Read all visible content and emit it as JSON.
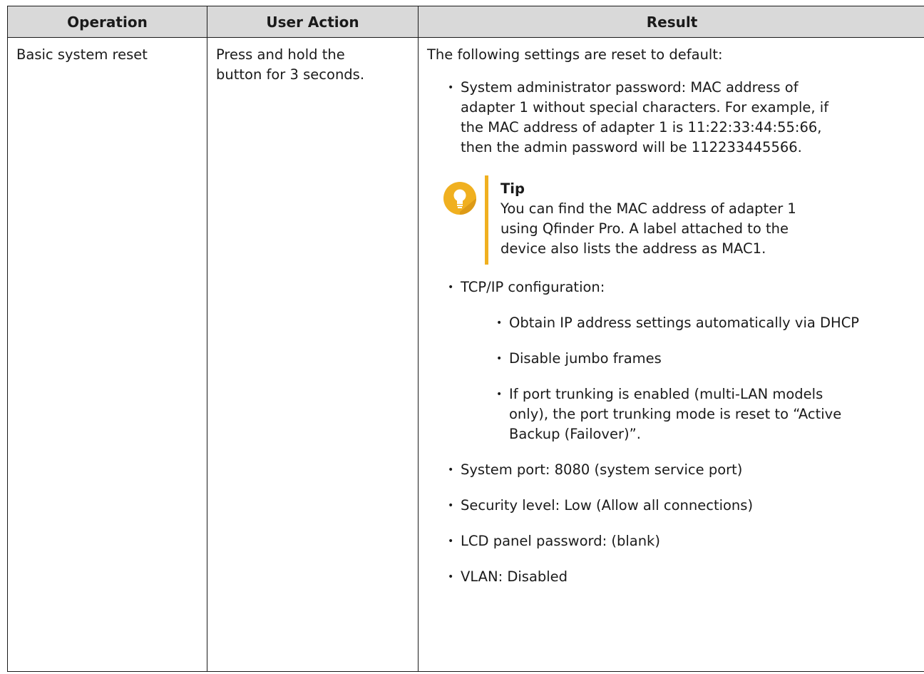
{
  "table": {
    "headers": {
      "operation": "Operation",
      "user_action": "User Action",
      "result": "Result"
    },
    "row": {
      "operation": "Basic system reset",
      "user_action_line1": "Press and hold the",
      "user_action_line2": "button for 3 seconds.",
      "result_intro": "The following settings are reset to default:",
      "admin_password_lines": [
        "System administrator password: MAC address of",
        "adapter 1 without special characters. For example, if",
        "the MAC address of adapter 1 is 11:22:33:44:55:66,",
        "then the admin password will be 112233445566."
      ],
      "tip": {
        "title": "Tip",
        "lines": [
          "You can find the MAC address of adapter 1",
          "using Qfinder Pro. A label attached to the",
          "device also lists the address as MAC1."
        ]
      },
      "tcpip_label": "TCP/IP configuration:",
      "tcpip_items": [
        "Obtain IP address settings automatically via DHCP",
        "Disable jumbo frames"
      ],
      "trunking_lines": [
        "If port trunking is enabled (multi-LAN models",
        "only), the port trunking mode is reset to “Active",
        "Backup (Failover)”."
      ],
      "system_port": "System port: 8080 (system service port)",
      "security_level": "Security level: Low (Allow all connections)",
      "lcd_password": "LCD panel password: (blank)",
      "vlan": "VLAN: Disabled"
    }
  },
  "colors": {
    "header_bg": "#d9d9d9",
    "tip_accent": "#f0b020"
  },
  "icons": {
    "tip": "lightbulb-icon"
  }
}
